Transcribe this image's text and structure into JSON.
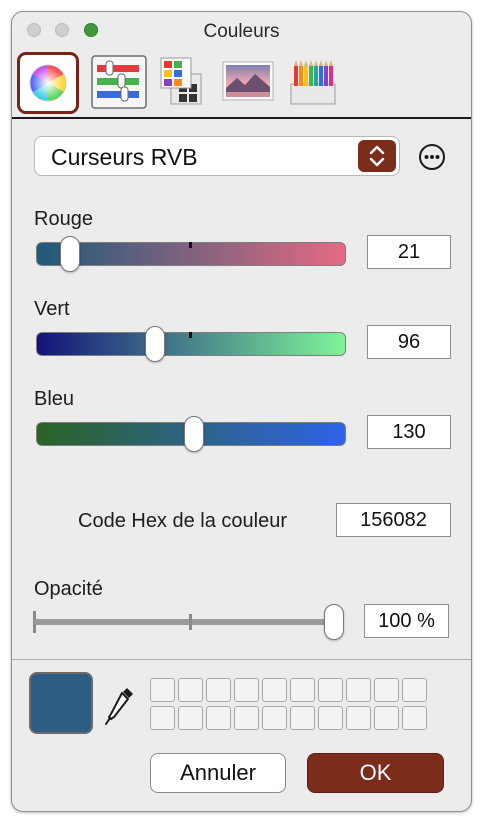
{
  "window": {
    "title": "Couleurs"
  },
  "toolbar": {
    "tools": [
      {
        "name": "color-wheel",
        "selected": true
      },
      {
        "name": "color-sliders",
        "selected": false
      },
      {
        "name": "color-palettes",
        "selected": false
      },
      {
        "name": "image-palettes",
        "selected": false
      },
      {
        "name": "pencils",
        "selected": false
      }
    ]
  },
  "mode_popup": {
    "label": "Curseurs RVB"
  },
  "sliders": [
    {
      "label": "Rouge",
      "value": "21",
      "max": 255,
      "gradient": [
        "#1f5a7a",
        "#e46a82"
      ]
    },
    {
      "label": "Vert",
      "value": "96",
      "max": 255,
      "gradient": [
        "#13137a",
        "#7ef59a"
      ]
    },
    {
      "label": "Bleu",
      "value": "130",
      "max": 255,
      "gradient": [
        "#2b6324",
        "#2f63e8"
      ]
    }
  ],
  "hex": {
    "label": "Code Hex de la couleur",
    "value": "156082"
  },
  "opacity": {
    "label": "Opacité",
    "value": "100 %",
    "fraction": 1.0
  },
  "current_color": "#2d5d82",
  "buttons": {
    "cancel": "Annuler",
    "ok": "OK"
  },
  "accent_color": "#7b2c1b"
}
